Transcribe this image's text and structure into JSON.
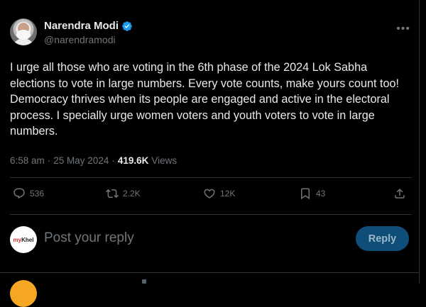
{
  "author": {
    "display_name": "Narendra Modi",
    "handle": "@narendramodi"
  },
  "tweet": {
    "text": "I urge all those who are voting in the 6th phase of the 2024 Lok Sabha elections to vote in large numbers. Every vote counts, make yours count too! Democracy thrives when its people are engaged and active in the electoral process. I specially urge women voters and youth voters to vote in large numbers.",
    "time": "6:58 am",
    "separator": "·",
    "date": "25 May 2024",
    "views_count": "419.6K",
    "views_label": "Views"
  },
  "actions": {
    "reply_count": "536",
    "retweet_count": "2.2K",
    "like_count": "12K",
    "bookmark_count": "43"
  },
  "reply_box": {
    "placeholder": "Post your reply",
    "button_label": "Reply",
    "avatar_text_main": "my",
    "avatar_text_accent": "Khel"
  },
  "icons": {
    "verified": "verified-badge-icon",
    "more": "more-icon",
    "reply": "reply-icon",
    "retweet": "retweet-icon",
    "like": "like-icon",
    "bookmark": "bookmark-icon",
    "share": "share-icon"
  },
  "colors": {
    "accent": "#1d9bf0",
    "muted": "#71767b",
    "text": "#e7e9ea",
    "reply_button_bg": "#0f4e79"
  }
}
